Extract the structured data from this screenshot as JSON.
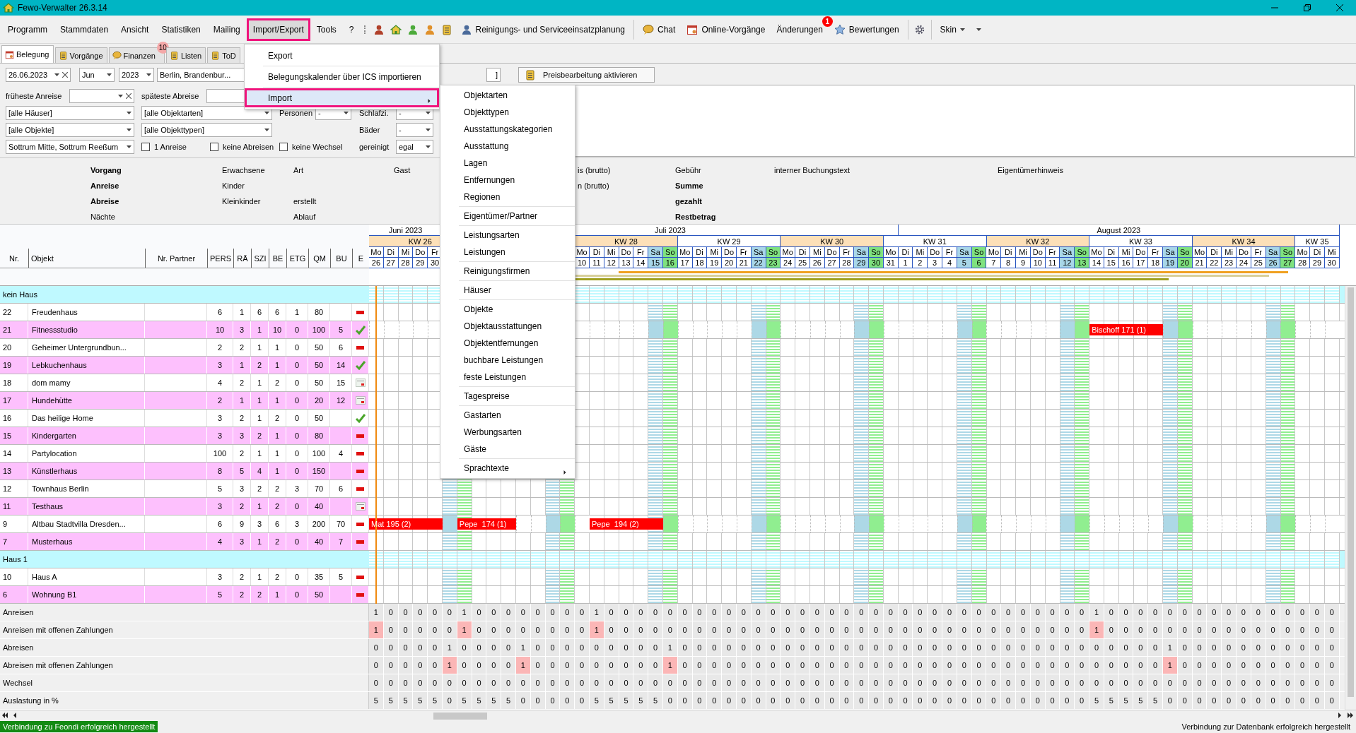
{
  "window": {
    "title": "Fewo-Verwalter 26.3.14"
  },
  "menubar": {
    "menus": [
      {
        "label": "Programm",
        "selected": false
      },
      {
        "label": "Stammdaten",
        "selected": false
      },
      {
        "label": "Ansicht",
        "selected": false
      },
      {
        "label": "Statistiken",
        "selected": false
      },
      {
        "label": "Mailing",
        "selected": false
      },
      {
        "label": "Import/Export",
        "selected": true
      },
      {
        "label": "Tools",
        "selected": false
      },
      {
        "label": "?",
        "selected": false
      }
    ],
    "tools": [
      {
        "label": "Reinigungs- und Serviceeinsatzplanung"
      },
      {
        "label": "Chat"
      },
      {
        "label": "Online-Vorgänge"
      },
      {
        "label": "Änderungen",
        "badge": "1"
      },
      {
        "label": "Bewertungen"
      }
    ],
    "skin": {
      "label": "Skin"
    }
  },
  "tabs": [
    {
      "label": "Belegung",
      "selected": true
    },
    {
      "label": "Vorgänge",
      "selected": false
    },
    {
      "label": "Finanzen",
      "selected": false,
      "badge": "10"
    },
    {
      "label": "Listen",
      "selected": false
    },
    {
      "label": "ToD",
      "selected": false
    }
  ],
  "filters": {
    "date": {
      "value": "26.06.2023"
    },
    "month": {
      "value": "Jun"
    },
    "year": {
      "value": "2023"
    },
    "region": {
      "value": "Berlin, Brandenbur..."
    },
    "field_5": {
      "value": "]"
    },
    "price_button": {
      "label": "Preisbearbeitung aktivieren"
    },
    "earliest_arrival": {
      "label": "früheste Anreise"
    },
    "latest_departure": {
      "label": "späteste Abreise"
    },
    "houses": {
      "value": "[alle Häuser]"
    },
    "object_kinds": {
      "value": "[alle Objektarten]"
    },
    "persons": {
      "label": "Personen",
      "value": "-"
    },
    "bedrooms": {
      "label": "Schlafzi.",
      "value": "-"
    },
    "objects": {
      "value": "[alle Objekte]"
    },
    "object_types": {
      "value": "[alle Objekttypen]"
    },
    "bathrooms": {
      "label": "Bäder",
      "value": "-"
    },
    "locations": {
      "value": "Sottrum Mitte, Sottrum Reeßum"
    },
    "checks": [
      {
        "label": "1 Anreise",
        "checked": false
      },
      {
        "label": "keine Abreisen",
        "checked": false
      },
      {
        "label": "keine Wechsel",
        "checked": false
      }
    ],
    "cleaned": {
      "label": "gereinigt",
      "value": "egal"
    }
  },
  "details": {
    "columns": [
      [
        {
          "text": "Vorgang",
          "bold": true
        },
        {
          "text": "Anreise",
          "bold": true
        },
        {
          "text": "Abreise",
          "bold": true
        },
        {
          "text": "Nächte",
          "bold": false
        }
      ],
      [
        {
          "text": "Erwachsene",
          "bold": false
        },
        {
          "text": "Kinder",
          "bold": false
        },
        {
          "text": "Kleinkinder",
          "bold": false
        }
      ],
      [
        {
          "text": "Art",
          "bold": false
        },
        null,
        {
          "text": "erstellt",
          "bold": false
        },
        {
          "text": "Ablauf",
          "bold": false
        }
      ],
      [
        {
          "text": "Gast",
          "bold": false
        }
      ],
      [
        {
          "text": "is (brutto)",
          "bold": false
        },
        {
          "text": "n (brutto)",
          "bold": false
        }
      ],
      [
        {
          "text": "Gebühr",
          "bold": false
        },
        {
          "text": "Summe",
          "bold": true
        },
        {
          "text": "gezahlt",
          "bold": true
        },
        {
          "text": "Restbetrag",
          "bold": true
        }
      ],
      [
        {
          "text": "interner Buchungstext",
          "bold": false
        }
      ],
      [
        {
          "text": "Eigentümerhinweis",
          "bold": false
        }
      ]
    ]
  },
  "grid": {
    "columns": [
      "Nr.",
      "Objekt",
      "Nr. Partner",
      "PERS",
      "RÄ",
      "SZI",
      "BE",
      "ETG",
      "QM",
      "BU",
      "E"
    ],
    "months": [
      {
        "label": "Juni 2023",
        "days": [
          {
            "day": "Mo",
            "date": "26",
            "kind": "weekday"
          },
          {
            "day": "Di",
            "date": "27",
            "kind": "weekday"
          },
          {
            "day": "Mi",
            "date": "28",
            "kind": "weekday"
          },
          {
            "day": "Do",
            "date": "29",
            "kind": "weekday"
          },
          {
            "day": "Fr",
            "date": "30",
            "kind": "weekday"
          }
        ]
      },
      {
        "label": "Juli 2023",
        "days": [
          {
            "kind": "saturday"
          },
          {
            "kind": "sunday"
          },
          {
            "kind": "weekday"
          },
          {
            "kind": "weekday"
          },
          {
            "kind": "weekday"
          },
          {
            "kind": "weekday"
          },
          {
            "kind": "weekday"
          },
          {
            "kind": "saturday"
          },
          {
            "kind": "sunday"
          },
          {
            "day": "Mo",
            "date": "10",
            "kind": "weekday"
          },
          {
            "day": "Di",
            "date": "11",
            "kind": "weekday"
          },
          {
            "day": "Mi",
            "date": "12",
            "kind": "weekday"
          },
          {
            "day": "Do",
            "date": "13",
            "kind": "weekday"
          },
          {
            "day": "Fr",
            "date": "14",
            "kind": "weekday"
          },
          {
            "day": "Sa",
            "date": "15",
            "kind": "saturday"
          },
          {
            "day": "So",
            "date": "16",
            "kind": "sunday"
          },
          {
            "day": "Mo",
            "date": "17",
            "kind": "weekday"
          },
          {
            "day": "Di",
            "date": "18",
            "kind": "weekday"
          },
          {
            "day": "Mi",
            "date": "19",
            "kind": "weekday"
          },
          {
            "day": "Do",
            "date": "20",
            "kind": "weekday"
          },
          {
            "day": "Fr",
            "date": "21",
            "kind": "weekday"
          },
          {
            "day": "Sa",
            "date": "22",
            "kind": "saturday"
          },
          {
            "day": "So",
            "date": "23",
            "kind": "sunday"
          },
          {
            "day": "Mo",
            "date": "24",
            "kind": "weekday"
          },
          {
            "day": "Di",
            "date": "25",
            "kind": "weekday"
          },
          {
            "day": "Mi",
            "date": "26",
            "kind": "weekday"
          },
          {
            "day": "Do",
            "date": "27",
            "kind": "weekday"
          },
          {
            "day": "Fr",
            "date": "28",
            "kind": "weekday"
          },
          {
            "day": "Sa",
            "date": "29",
            "kind": "saturday"
          },
          {
            "day": "So",
            "date": "30",
            "kind": "sunday"
          },
          {
            "day": "Mo",
            "date": "31",
            "kind": "weekday"
          }
        ]
      },
      {
        "label": "August 2023",
        "days": [
          {
            "day": "Di",
            "date": "1",
            "kind": "weekday"
          },
          {
            "day": "Mi",
            "date": "2",
            "kind": "weekday"
          },
          {
            "day": "Do",
            "date": "3",
            "kind": "weekday"
          },
          {
            "day": "Fr",
            "date": "4",
            "kind": "weekday"
          },
          {
            "day": "Sa",
            "date": "5",
            "kind": "saturday"
          },
          {
            "day": "So",
            "date": "6",
            "kind": "sunday"
          },
          {
            "day": "Mo",
            "date": "7",
            "kind": "weekday"
          },
          {
            "day": "Di",
            "date": "8",
            "kind": "weekday"
          },
          {
            "day": "Mi",
            "date": "9",
            "kind": "weekday"
          },
          {
            "day": "Do",
            "date": "10",
            "kind": "weekday"
          },
          {
            "day": "Fr",
            "date": "11",
            "kind": "weekday"
          },
          {
            "day": "Sa",
            "date": "12",
            "kind": "saturday"
          },
          {
            "day": "So",
            "date": "13",
            "kind": "sunday"
          },
          {
            "day": "Mo",
            "date": "14",
            "kind": "weekday"
          },
          {
            "day": "Di",
            "date": "15",
            "kind": "weekday"
          },
          {
            "day": "Mi",
            "date": "16",
            "kind": "weekday"
          },
          {
            "day": "Do",
            "date": "17",
            "kind": "weekday"
          },
          {
            "day": "Fr",
            "date": "18",
            "kind": "weekday"
          },
          {
            "day": "Sa",
            "date": "19",
            "kind": "saturday"
          },
          {
            "day": "So",
            "date": "20",
            "kind": "sunday"
          },
          {
            "day": "Mo",
            "date": "21",
            "kind": "weekday"
          },
          {
            "day": "Di",
            "date": "22",
            "kind": "weekday"
          },
          {
            "day": "Mi",
            "date": "23",
            "kind": "weekday"
          },
          {
            "day": "Do",
            "date": "24",
            "kind": "weekday"
          },
          {
            "day": "Fr",
            "date": "25",
            "kind": "weekday"
          },
          {
            "day": "Sa",
            "date": "26",
            "kind": "saturday"
          },
          {
            "day": "So",
            "date": "27",
            "kind": "sunday"
          },
          {
            "day": "Mo",
            "date": "28",
            "kind": "weekday"
          },
          {
            "day": "Di",
            "date": "29",
            "kind": "weekday"
          },
          {
            "day": "Mi",
            "date": "30",
            "kind": "weekday"
          }
        ]
      }
    ],
    "weeks": [
      "KW 26",
      "KW 28",
      "KW 29",
      "KW 30",
      "KW 31",
      "KW 32",
      "KW 33",
      "KW 34",
      "KW 35"
    ],
    "groups": [
      {
        "label": "kein Haus",
        "rows": [
          {
            "nr": "22",
            "name": "Freudenhaus",
            "values": [
              "6",
              "1",
              "6",
              "6",
              "1",
              "80"
            ],
            "kind": "dash"
          },
          {
            "nr": "21",
            "name": "Fitnessstudio",
            "values": [
              "10",
              "3",
              "1",
              "10",
              "0",
              "100"
            ],
            "bu": "5",
            "kind": "check",
            "bookings": [
              {
                "label": "Bischoff 171 (1)"
              }
            ],
            "booked_days": [
              false,
              false,
              false,
              false,
              false,
              false,
              false,
              false,
              false,
              false,
              false,
              false,
              false,
              false,
              false,
              false,
              false,
              false,
              false,
              false,
              false,
              false,
              false,
              false,
              false,
              false,
              false,
              false,
              false,
              false,
              false,
              false,
              false,
              false,
              false,
              false,
              false,
              false,
              false,
              false,
              false,
              false,
              false,
              false,
              false,
              false,
              false,
              false,
              false,
              true,
              true,
              true,
              true,
              true,
              false,
              false,
              false,
              false,
              false,
              false,
              false,
              false,
              false,
              false,
              false,
              false
            ]
          },
          {
            "nr": "20",
            "name": "Geheimer Untergrundbun...",
            "values": [
              "2",
              "2",
              "1",
              "1",
              "0",
              "50"
            ],
            "bu": "6",
            "kind": "dash"
          },
          {
            "nr": "19",
            "name": "Lebkuchenhaus",
            "values": [
              "3",
              "1",
              "2",
              "1",
              "0",
              "50"
            ],
            "bu": "14",
            "kind": "check"
          },
          {
            "nr": "18",
            "name": "dom mamy",
            "values": [
              "4",
              "2",
              "1",
              "2",
              "0",
              "50"
            ],
            "bu": "15",
            "kind": "calendar"
          },
          {
            "nr": "17",
            "name": "Hundehütte",
            "values": [
              "2",
              "1",
              "1",
              "1",
              "0",
              "20"
            ],
            "bu": "12",
            "kind": "calendar"
          },
          {
            "nr": "16",
            "name": "Das heilige Home",
            "values": [
              "3",
              "2",
              "1",
              "2",
              "0",
              "50"
            ],
            "kind": "check"
          },
          {
            "nr": "15",
            "name": "Kindergarten",
            "values": [
              "3",
              "3",
              "2",
              "1",
              "0",
              "80"
            ],
            "kind": "dash"
          },
          {
            "nr": "14",
            "name": "Partylocation",
            "values": [
              "100",
              "2",
              "1",
              "1",
              "0",
              "100"
            ],
            "bu": "4",
            "kind": "dash"
          },
          {
            "nr": "13",
            "name": "Künstlerhaus",
            "values": [
              "8",
              "5",
              "4",
              "1",
              "0",
              "150"
            ],
            "kind": "dash"
          },
          {
            "nr": "12",
            "name": "Townhaus Berlin",
            "values": [
              "5",
              "3",
              "2",
              "2",
              "3",
              "70"
            ],
            "bu": "6",
            "kind": "dash"
          },
          {
            "nr": "11",
            "name": "Testhaus",
            "values": [
              "3",
              "2",
              "1",
              "2",
              "0",
              "40"
            ],
            "kind": "calendar"
          },
          {
            "nr": "9",
            "name": "Altbau Stadtvilla Dresden...",
            "values": [
              "6",
              "9",
              "3",
              "6",
              "3",
              "200"
            ],
            "bu": "70",
            "kind": "dash",
            "bookings": [
              {
                "label": "Mat 195 (2)"
              },
              {
                "label": "Pepe  174 (1)"
              },
              {
                "label": "Pepe  194 (2)"
              }
            ],
            "booked_days": [
              true,
              true,
              true,
              true,
              true,
              false,
              true,
              true,
              true,
              true,
              false,
              false,
              false,
              false,
              false,
              true,
              true,
              true,
              true,
              true,
              false,
              false,
              false,
              false,
              false,
              false,
              false,
              false,
              false,
              false,
              false,
              false,
              false,
              false,
              false,
              false,
              false,
              false,
              false,
              false,
              false,
              false,
              false,
              false,
              false,
              false,
              false,
              false,
              false,
              false,
              false,
              false,
              false,
              false,
              false,
              false,
              false,
              false,
              false,
              false,
              false,
              false,
              false,
              false,
              false,
              false
            ]
          },
          {
            "nr": "7",
            "name": "Musterhaus",
            "values": [
              "4",
              "3",
              "1",
              "2",
              "0",
              "40"
            ],
            "bu": "7",
            "kind": "dash"
          }
        ]
      },
      {
        "label": "Haus 1",
        "rows": [
          {
            "nr": "10",
            "name": "Haus A",
            "values": [
              "3",
              "2",
              "1",
              "2",
              "0",
              "35"
            ],
            "bu": "5",
            "kind": "dash"
          },
          {
            "nr": "6",
            "name": "Wohnung B1",
            "values": [
              "5",
              "2",
              "2",
              "1",
              "0",
              "50"
            ],
            "kind": "dash"
          }
        ]
      }
    ]
  },
  "summary": {
    "rows": [
      {
        "label": "Anreisen",
        "values": [
          "1",
          "0",
          "0",
          "0",
          "0",
          "0",
          "1",
          "0",
          "0",
          "0",
          "0",
          "0",
          "0",
          "0",
          "0",
          "1",
          "0",
          "0",
          "0",
          "0",
          "0",
          "0",
          "0",
          "0",
          "0",
          "0",
          "0",
          "0",
          "0",
          "0",
          "0",
          "0",
          "0",
          "0",
          "0",
          "0",
          "0",
          "0",
          "0",
          "0",
          "0",
          "0",
          "0",
          "0",
          "0",
          "0",
          "0",
          "0",
          "0",
          "1",
          "0",
          "0",
          "0",
          "0",
          "0",
          "0",
          "0",
          "0",
          "0",
          "0",
          "0",
          "0",
          "0",
          "0",
          "0",
          "0"
        ]
      },
      {
        "label": "Anreisen mit offenen Zahlungen",
        "values": [
          {
            "value": "1",
            "marked": true
          },
          "0",
          "0",
          "0",
          "0",
          "0",
          {
            "value": "1",
            "marked": true
          },
          "0",
          "0",
          "0",
          "0",
          "0",
          "0",
          "0",
          "0",
          {
            "value": "1",
            "marked": true
          },
          "0",
          "0",
          "0",
          "0",
          "0",
          "0",
          "0",
          "0",
          "0",
          "0",
          "0",
          "0",
          "0",
          "0",
          "0",
          "0",
          "0",
          "0",
          "0",
          "0",
          "0",
          "0",
          "0",
          "0",
          "0",
          "0",
          "0",
          "0",
          "0",
          "0",
          "0",
          "0",
          "0",
          {
            "value": "1",
            "marked": true
          },
          "0",
          "0",
          "0",
          "0",
          "0",
          "0",
          "0",
          "0",
          "0",
          "0",
          "0",
          "0",
          "0",
          "0",
          "0",
          "0"
        ]
      },
      {
        "label": "Abreisen",
        "values": [
          "0",
          "0",
          "0",
          "0",
          "0",
          "1",
          "0",
          "0",
          "0",
          "0",
          "1",
          "0",
          "0",
          "0",
          "0",
          "0",
          "0",
          "0",
          "0",
          "0",
          "1",
          "0",
          "0",
          "0",
          "0",
          "0",
          "0",
          "0",
          "0",
          "0",
          "0",
          "0",
          "0",
          "0",
          "0",
          "0",
          "0",
          "0",
          "0",
          "0",
          "0",
          "0",
          "0",
          "0",
          "0",
          "0",
          "0",
          "0",
          "0",
          "0",
          "0",
          "0",
          "0",
          "0",
          "1",
          "0",
          "0",
          "0",
          "0",
          "0",
          "0",
          "0",
          "0",
          "0",
          "0",
          "0"
        ]
      },
      {
        "label": "Abreisen mit offenen Zahlungen",
        "values": [
          "0",
          "0",
          "0",
          "0",
          "0",
          {
            "value": "1",
            "marked": true
          },
          "0",
          "0",
          "0",
          "0",
          {
            "value": "1",
            "marked": true
          },
          "0",
          "0",
          "0",
          "0",
          "0",
          "0",
          "0",
          "0",
          "0",
          {
            "value": "1",
            "marked": true
          },
          "0",
          "0",
          "0",
          "0",
          "0",
          "0",
          "0",
          "0",
          "0",
          "0",
          "0",
          "0",
          "0",
          "0",
          "0",
          "0",
          "0",
          "0",
          "0",
          "0",
          "0",
          "0",
          "0",
          "0",
          "0",
          "0",
          "0",
          "0",
          "0",
          "0",
          "0",
          "0",
          "0",
          {
            "value": "1",
            "marked": true
          },
          "0",
          "0",
          "0",
          "0",
          "0",
          "0",
          "0",
          "0",
          "0",
          "0",
          "0"
        ]
      },
      {
        "label": "Wechsel",
        "values": [
          "0",
          "0",
          "0",
          "0",
          "0",
          "0",
          "0",
          "0",
          "0",
          "0",
          "0",
          "0",
          "0",
          "0",
          "0",
          "0",
          "0",
          "0",
          "0",
          "0",
          "0",
          "0",
          "0",
          "0",
          "0",
          "0",
          "0",
          "0",
          "0",
          "0",
          "0",
          "0",
          "0",
          "0",
          "0",
          "0",
          "0",
          "0",
          "0",
          "0",
          "0",
          "0",
          "0",
          "0",
          "0",
          "0",
          "0",
          "0",
          "0",
          "0",
          "0",
          "0",
          "0",
          "0",
          "0",
          "0",
          "0",
          "0",
          "0",
          "0",
          "0",
          "0",
          "0",
          "0",
          "0",
          "0"
        ]
      },
      {
        "label": "Auslastung in %",
        "values": [
          "5",
          "5",
          "5",
          "5",
          "5",
          "0",
          "5",
          "5",
          "5",
          "5",
          "0",
          "0",
          "0",
          "0",
          "0",
          "5",
          "5",
          "5",
          "5",
          "5",
          "0",
          "0",
          "0",
          "0",
          "0",
          "0",
          "0",
          "0",
          "0",
          "0",
          "0",
          "0",
          "0",
          "0",
          "0",
          "0",
          "0",
          "0",
          "0",
          "0",
          "0",
          "0",
          "0",
          "0",
          "0",
          "0",
          "0",
          "0",
          "0",
          "5",
          "5",
          "5",
          "5",
          "5",
          "0",
          "0",
          "0",
          "0",
          "0",
          "0",
          "0",
          "0",
          "0",
          "0",
          "0",
          "0"
        ]
      }
    ]
  },
  "import_export_menu": {
    "items": [
      {
        "label": "Export",
        "selected": false,
        "has_submenu": false
      },
      {
        "label": "Belegungskalender über ICS importieren",
        "selected": false,
        "has_submenu": false
      },
      {
        "label": "Import",
        "selected": true,
        "has_submenu": true
      }
    ],
    "submenu": [
      [
        {
          "label": "Objektarten",
          "has_submenu": false
        },
        {
          "label": "Objekttypen",
          "has_submenu": false
        },
        {
          "label": "Ausstattungskategorien",
          "has_submenu": false
        },
        {
          "label": "Ausstattung",
          "has_submenu": false
        },
        {
          "label": "Lagen",
          "has_submenu": false
        },
        {
          "label": "Entfernungen",
          "has_submenu": false
        },
        {
          "label": "Regionen",
          "has_submenu": false
        }
      ],
      [
        {
          "label": "Eigentümer/Partner",
          "has_submenu": false
        }
      ],
      [
        {
          "label": "Leistungsarten",
          "has_submenu": false
        },
        {
          "label": "Leistungen",
          "has_submenu": false
        }
      ],
      [
        {
          "label": "Reinigungsfirmen",
          "has_submenu": false
        }
      ],
      [
        {
          "label": "Häuser",
          "has_submenu": false
        }
      ],
      [
        {
          "label": "Objekte",
          "has_submenu": false
        },
        {
          "label": "Objektausstattungen",
          "has_submenu": false
        },
        {
          "label": "Objektentfernungen",
          "has_submenu": false
        },
        {
          "label": "buchbare Leistungen",
          "has_submenu": false
        },
        {
          "label": "feste Leistungen",
          "has_submenu": false
        }
      ],
      [
        {
          "label": "Tagespreise",
          "has_submenu": false
        }
      ],
      [
        {
          "label": "Gastarten",
          "has_submenu": false
        },
        {
          "label": "Werbungsarten",
          "has_submenu": false
        },
        {
          "label": "Gäste",
          "has_submenu": false
        }
      ],
      [
        {
          "label": "Sprachtexte",
          "has_submenu": true
        }
      ]
    ]
  },
  "status_bar": {
    "left": "Verbindung zu Feondi erfolgreich hergestellt",
    "right": "Verbindung zur Datenbank erfolgreich hergestellt"
  }
}
